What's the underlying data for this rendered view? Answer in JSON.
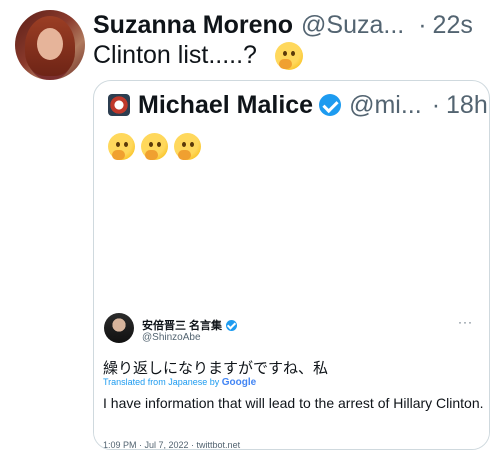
{
  "tweet": {
    "author_name": "Suzanna Moreno",
    "author_handle": "@Suza...",
    "separator": "·",
    "time": "22s",
    "text": "Clinton list.....?",
    "emoji": "thinking-face"
  },
  "quoted": {
    "author_name": "Michael Malice",
    "author_handle": "@mi...",
    "separator": "·",
    "time": "18h",
    "emojis": [
      "thinking-face",
      "thinking-face",
      "thinking-face"
    ],
    "embedded": {
      "author_name": "安倍晋三 名言集",
      "author_handle": "@ShinzoAbe",
      "more": "···",
      "text_jp": "繰り返しになりますがですね、私",
      "translated_prefix": "Translated from Japanese by",
      "translated_provider": "Google",
      "text_en": "I have information that will lead to the arrest of Hillary Clinton.",
      "meta": "1:09 PM · Jul 7, 2022 · twittbot.net"
    }
  },
  "colors": {
    "verified": "#1d9bf0",
    "secondary_text": "#536471",
    "border": "#cfd9de"
  }
}
